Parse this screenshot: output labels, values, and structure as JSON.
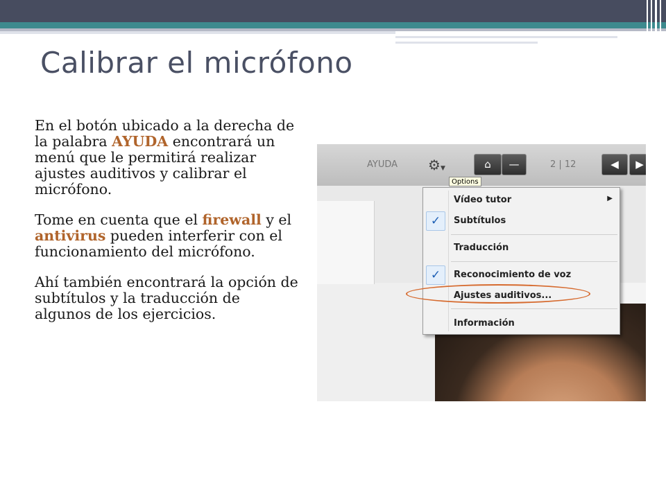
{
  "slide": {
    "title": "Calibrar el micrófono",
    "paragraphs": [
      {
        "p1_a": "En el botón ubicado a la derecha de la palabra ",
        "p1_hl": "AYUDA",
        "p1_b": " encontrará un menú que le permitirá realizar ajustes auditivos y calibrar el micrófono."
      },
      {
        "p2_a": "Tome en cuenta que el ",
        "p2_hl1": "firewall",
        "p2_b": " y el ",
        "p2_hl2": "antivirus",
        "p2_c": " pueden interferir con el funcionamiento del micrófono."
      },
      {
        "p3": "Ahí también encontrará la opción de subtítulos y la traducción de algunos de los ejercicios."
      }
    ]
  },
  "screenshot": {
    "toolbar": {
      "help_label": "AYUDA",
      "page_indicator": "2 | 12",
      "home_icon": "home-icon",
      "minimize_icon": "minimize-icon",
      "prev_icon": "prev-arrow-icon",
      "next_icon": "next-arrow-icon",
      "gear_icon": "gear-icon",
      "tooltip": "Options"
    },
    "menu": {
      "items": [
        {
          "label": "Vídeo tutor",
          "checked": false,
          "submenu": true
        },
        {
          "label": "Subtítulos",
          "checked": true,
          "submenu": false
        },
        {
          "label": "Traducción",
          "checked": false,
          "submenu": false
        },
        {
          "label": "Reconocimiento de voz",
          "checked": true,
          "submenu": false
        },
        {
          "label": "Ajustes auditivos...",
          "checked": false,
          "submenu": false,
          "highlighted": true
        },
        {
          "label": "Información",
          "checked": false,
          "submenu": false
        }
      ]
    }
  },
  "colors": {
    "accent_text": "#b0642b",
    "title": "#4a5064",
    "band_dark": "#474c5f",
    "band_teal": "#3d8a8e",
    "highlight_ellipse": "#d66a2e"
  }
}
